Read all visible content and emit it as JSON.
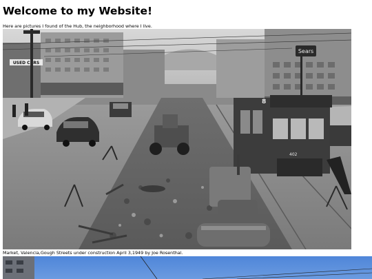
{
  "page": {
    "title": "Welcome to my Website!",
    "intro": "Here are pictures I found of the Hub, the neighborhood where I live.",
    "caption": "Market, Valencia,Gough Streets under construction April 3,1949 by Joe Rosenthal."
  },
  "photo1": {
    "signs": {
      "used_cars": "USED CARS",
      "streetcar_number": "8",
      "streetcar_plate": "402",
      "store_sign": "Sears"
    }
  }
}
